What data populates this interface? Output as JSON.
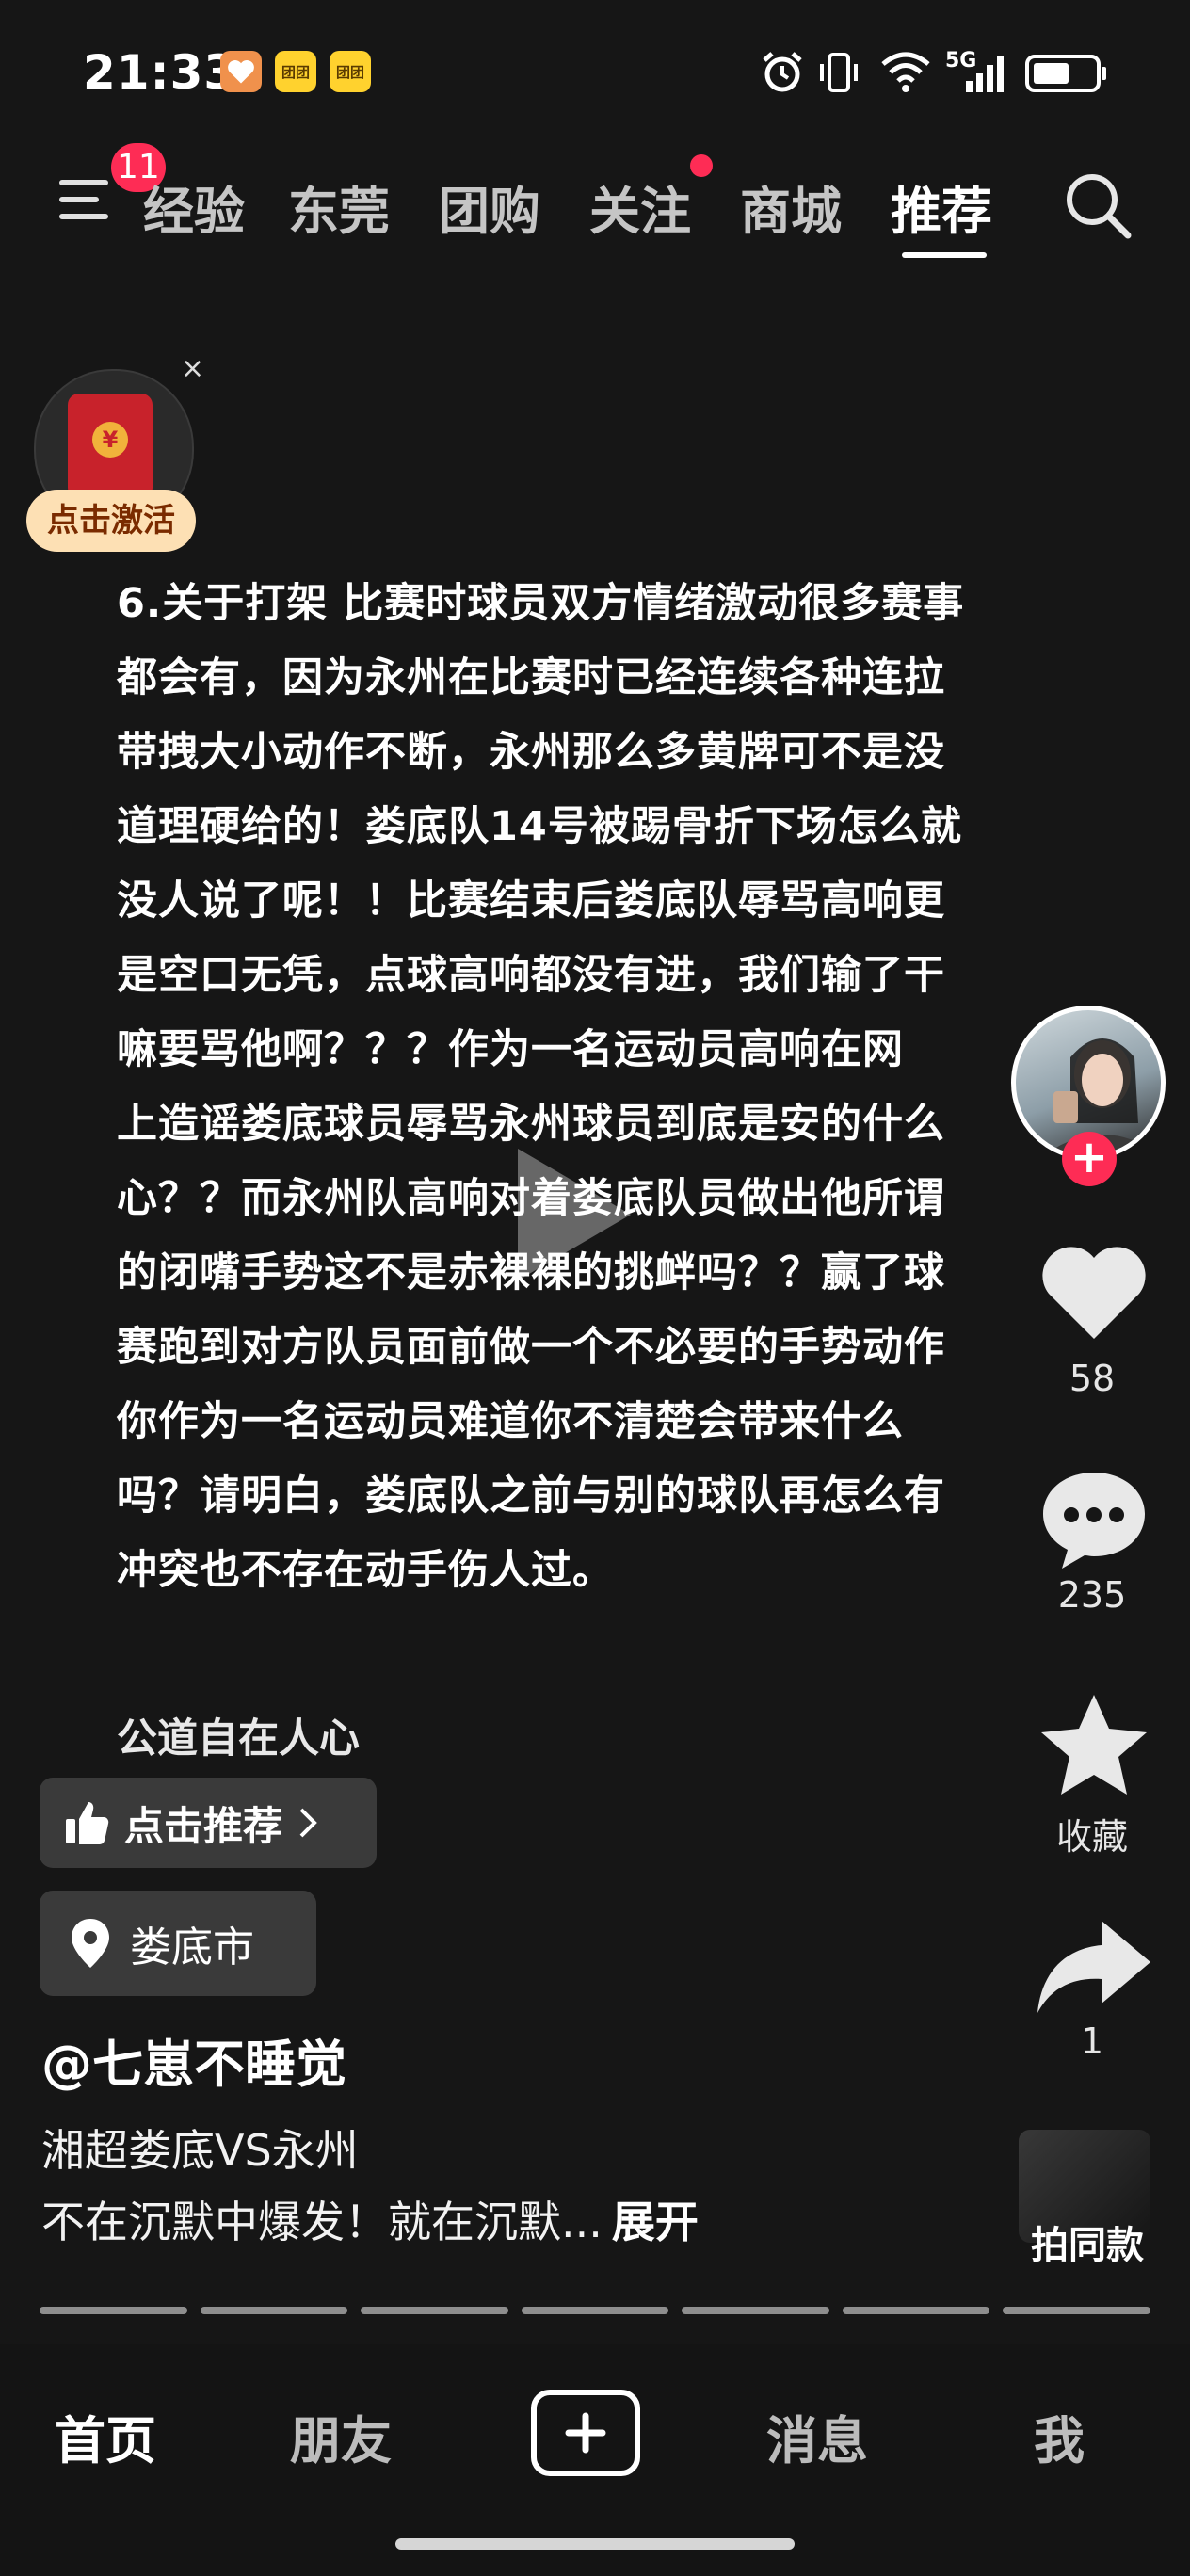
{
  "status_bar": {
    "time": "21:33",
    "app_badges": [
      "heart-app-icon",
      "meituan-app-icon",
      "meituan-app-icon"
    ],
    "app_badge_text": "团团",
    "network": "5G",
    "battery_level": 0.6
  },
  "top_nav": {
    "menu_badge": "11",
    "tabs": [
      "经验",
      "东莞",
      "团购",
      "关注",
      "商城",
      "推荐"
    ],
    "active_tab": "推荐",
    "follow_has_dot": true
  },
  "red_envelope": {
    "label": "点击激活",
    "close": "×",
    "coin": "¥"
  },
  "post": {
    "text": "6.关于打架 比赛时球员双方情绪激动很多赛事\n都会有，因为永州在比赛时已经连续各种连拉\n带拽大小动作不断，永州那么多黄牌可不是没\n道理硬给的！娄底队14号被踢骨折下场怎么就\n没人说了呢！！比赛结束后娄底队辱骂高响更\n是空口无凭，点球高响都没有进，我们输了干\n嘛要骂他啊？？？作为一名运动员高响在网\n上造谣娄底球员辱骂永州球员到底是安的什么\n心？？而永州队高响对着娄底队员做出他所谓\n的闭嘴手势这不是赤裸裸的挑衅吗？？赢了球\n赛跑到对方队员面前做一个不必要的手势动作\n你作为一名运动员难道你不清楚会带来什么\n吗？请明白，娄底队之前与别的球队再怎么有\n冲突也不存在动手伤人过。",
    "footer": "公道自在人心"
  },
  "side_actions": {
    "like_count": "58",
    "comment_count": "235",
    "favorite_label": "收藏",
    "share_count": "1",
    "same_style_label": "拍同款"
  },
  "info": {
    "recommend_label": "点击推荐",
    "location": "娄底市",
    "author": "@七崽不睡觉",
    "title": "湘超娄底VS永州",
    "desc": "不在沉默中爆发！就在沉默...",
    "expand": "展开"
  },
  "progress_segments": 7,
  "bottom_nav": {
    "home": "首页",
    "friends": "朋友",
    "messages": "消息",
    "me": "我",
    "active": "首页"
  },
  "colors": {
    "accent": "#fe2c55",
    "background": "#161616"
  }
}
